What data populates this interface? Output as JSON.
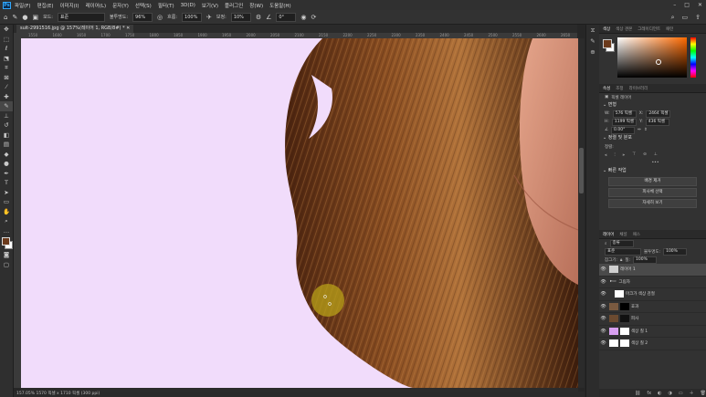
{
  "menu": {
    "logo": "Ps",
    "items": [
      "파일(F)",
      "편집(E)",
      "이미지(I)",
      "레이어(L)",
      "문자(Y)",
      "선택(S)",
      "필터(T)",
      "3D(D)",
      "보기(V)",
      "플러그인",
      "창(W)",
      "도움말(H)"
    ]
  },
  "window_controls": {
    "minimize": "–",
    "maximize": "□",
    "close": "✕"
  },
  "options": {
    "mode_label": "모드:",
    "mode_value": "표준",
    "opacity_label": "불투명도:",
    "opacity_value": "96%",
    "flow_label": "흐름:",
    "flow_value": "100%",
    "smoothing_label": "보정:",
    "smoothing_value": "10%",
    "angle_value": "0°"
  },
  "document": {
    "tab_title": "suit-2991516.jpg @ 157%(레이어 1, RGB/8#) *",
    "ruler_marks": [
      "1550",
      "1600",
      "1650",
      "1700",
      "1750",
      "1800",
      "1850",
      "1900",
      "1950",
      "2000",
      "2050",
      "2100",
      "2150",
      "2200",
      "2250",
      "2300",
      "2350",
      "2400",
      "2450",
      "2500",
      "2550",
      "2600",
      "2650"
    ],
    "status": "157.05%   1570 픽셀 x 1710 픽셀 (300 ppi)"
  },
  "color_panel": {
    "tabs": [
      "색상",
      "색상 견본",
      "그레이디언트",
      "패턴"
    ],
    "foreground": "#6b3a1c",
    "background": "#ffffff"
  },
  "properties_panel": {
    "tabs": [
      "속성",
      "조정",
      "라이브러리"
    ],
    "layer_kind": "픽셀 레이어",
    "transform_label": "변형",
    "w_label": "W:",
    "w_value": "576 픽셀",
    "x_label": "X:",
    "x_value": "2464 픽셀",
    "h_label": "H:",
    "h_value": "1199 픽셀",
    "y_label": "Y:",
    "y_value": "436 픽셀",
    "angle_value": "0.00°",
    "align_label": "정렬 및 분포",
    "align_sub": "정렬:",
    "quick_actions_label": "빠른 작업",
    "actions": [
      "배경 제거",
      "피사체 선택",
      "자세히 보기"
    ]
  },
  "layers_panel": {
    "tabs": [
      "레이어",
      "채널",
      "패스"
    ],
    "kind_label": "종류",
    "blend_mode": "표준",
    "opacity_label": "불투명도:",
    "opacity_value": "100%",
    "lock_label": "잠그기:",
    "fill_label": "칠:",
    "fill_value": "100%",
    "layers": [
      {
        "name": "레이어 1",
        "color": "#cfcfcf",
        "selected": true
      },
      {
        "name": "그림자",
        "color": "#3a3a3a",
        "selected": false
      },
      {
        "name": "마크가 색상 검절",
        "color": "#ffffff",
        "selected": false
      },
      {
        "name": "효과",
        "color": "#7a5a40",
        "selected": false
      },
      {
        "name": "피사",
        "color": "#6b4a30",
        "selected": false
      },
      {
        "name": "색상 칠 1",
        "color": "#d8a0f0",
        "selected": false
      },
      {
        "name": "색상 칠 2",
        "color": "#ffffff",
        "selected": false
      }
    ],
    "bottom_icons": [
      "link-icon",
      "fx-icon",
      "mask-icon",
      "adjustment-icon",
      "group-icon",
      "new-layer-icon",
      "trash-icon"
    ]
  },
  "colors": {
    "canvas_bg": "#f1dcfb",
    "hair_dark": "#5a2e14",
    "hair_light": "#b07238",
    "skin": "#d9957c",
    "brush_cursor": "#b8a018"
  }
}
